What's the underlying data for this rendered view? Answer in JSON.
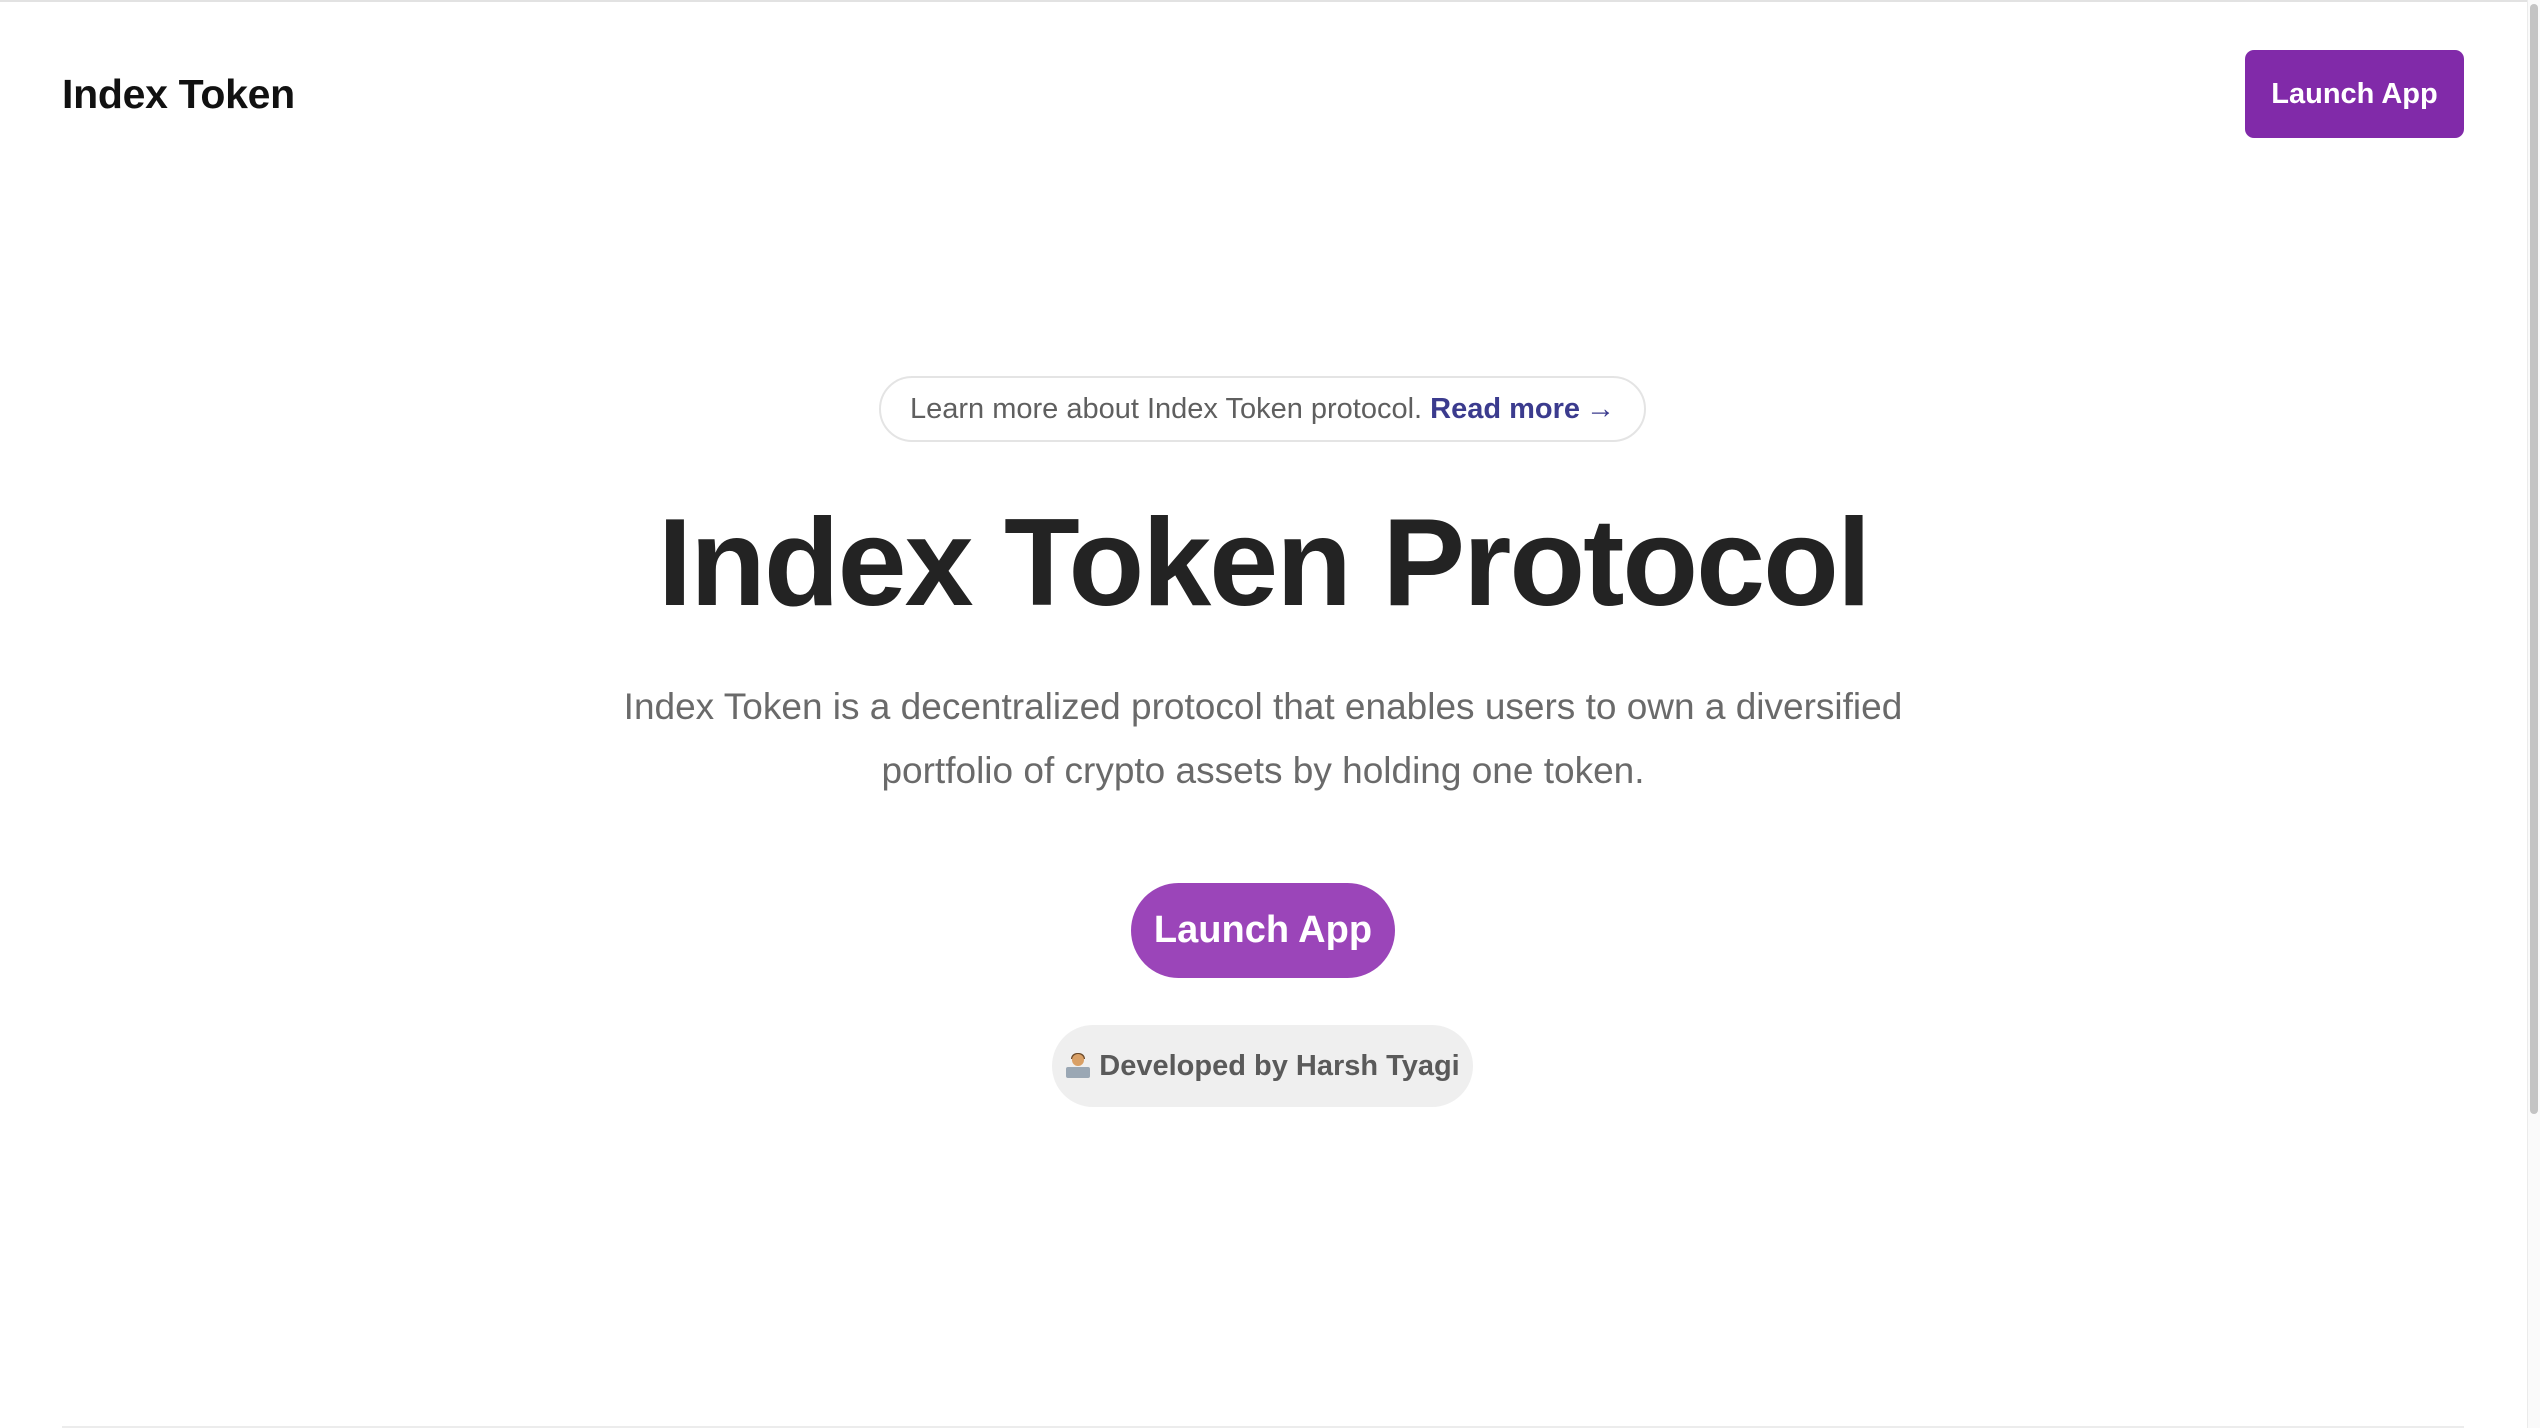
{
  "header": {
    "brand": "Index Token",
    "launch_label": "Launch App"
  },
  "announcement": {
    "text": "Learn more about Index Token protocol.",
    "link_label": "Read more",
    "arrow": "→"
  },
  "hero": {
    "title": "Index Token Protocol",
    "description": "Index Token is a decentralized protocol that enables users to own a diversified portfolio of crypto assets by holding one token.",
    "launch_label": "Launch App"
  },
  "credit": {
    "icon": "technologist-icon",
    "text": "Developed by Harsh Tyagi"
  },
  "colors": {
    "header_button": "#812aa9",
    "hero_button": "#9b45b9",
    "link": "#3b3b8e"
  }
}
